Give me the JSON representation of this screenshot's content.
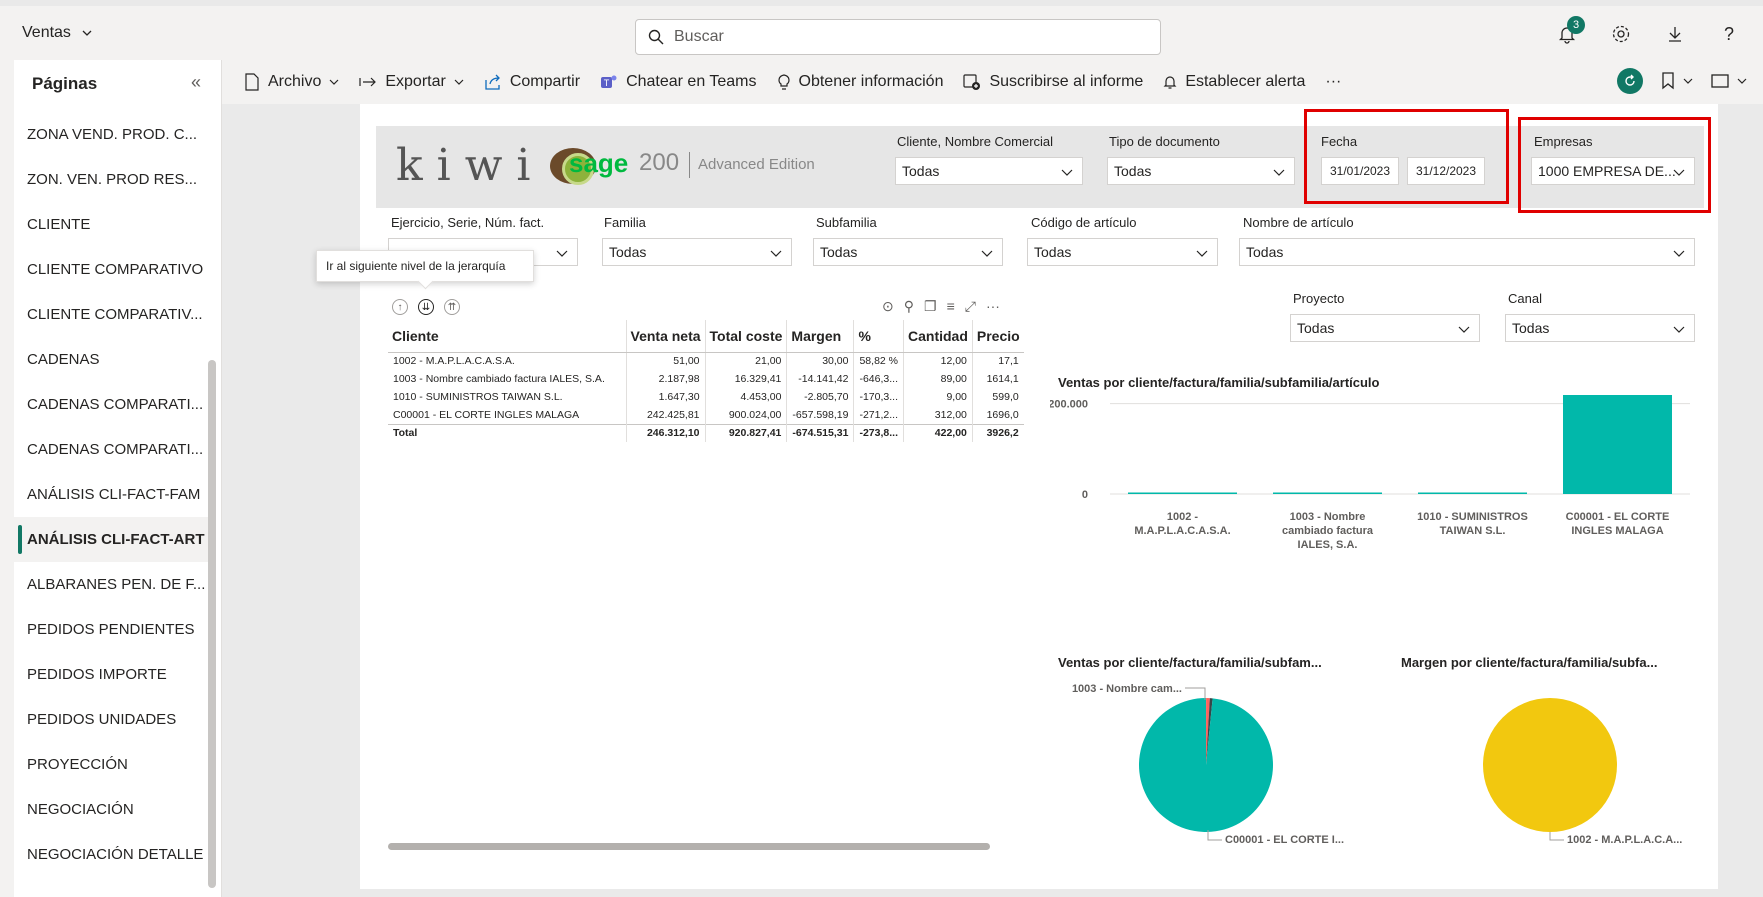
{
  "workspace": {
    "name": "Ventas"
  },
  "search": {
    "placeholder": "Buscar"
  },
  "notifications": {
    "count": "3"
  },
  "sidebar": {
    "title": "Páginas",
    "items": [
      {
        "label": "ZONA VEND. PROD. C..."
      },
      {
        "label": "ZON. VEN. PROD RES..."
      },
      {
        "label": "CLIENTE"
      },
      {
        "label": "CLIENTE COMPARATIVO"
      },
      {
        "label": "CLIENTE COMPARATIV..."
      },
      {
        "label": "CADENAS"
      },
      {
        "label": "CADENAS COMPARATI..."
      },
      {
        "label": "CADENAS COMPARATI..."
      },
      {
        "label": "ANÁLISIS CLI-FACT-FAM"
      },
      {
        "label": "ANÁLISIS CLI-FACT-ART",
        "active": true
      },
      {
        "label": "ALBARANES PEN. DE F..."
      },
      {
        "label": "PEDIDOS PENDIENTES"
      },
      {
        "label": "PEDIDOS IMPORTE"
      },
      {
        "label": "PEDIDOS UNIDADES"
      },
      {
        "label": "PROYECCIÓN"
      },
      {
        "label": "NEGOCIACIÓN"
      },
      {
        "label": "NEGOCIACIÓN DETALLE"
      }
    ]
  },
  "toolbar": {
    "archivo": "Archivo",
    "exportar": "Exportar",
    "compartir": "Compartir",
    "teams": "Chatear en Teams",
    "info": "Obtener información",
    "suscribirse": "Suscribirse al informe",
    "alerta": "Establecer alerta",
    "more": "···"
  },
  "header": {
    "kiwi": "kiwi",
    "sage": "sage",
    "sage_version": "200",
    "edition": "Advanced Edition"
  },
  "slicers": {
    "cliente": {
      "label": "Cliente, Nombre Comercial",
      "value": "Todas"
    },
    "tipo_doc": {
      "label": "Tipo de documento",
      "value": "Todas"
    },
    "fecha": {
      "label": "Fecha",
      "from": "31/01/2023",
      "to": "31/12/2023"
    },
    "empresas": {
      "label": "Empresas",
      "value": "1000 EMPRESA DE..."
    },
    "ejercicio": {
      "label": "Ejercicio, Serie, Núm. fact."
    },
    "familia": {
      "label": "Familia",
      "value": "Todas"
    },
    "subfamilia": {
      "label": "Subfamilia",
      "value": "Todas"
    },
    "codigo": {
      "label": "Código de artículo",
      "value": "Todas"
    },
    "nombre": {
      "label": "Nombre de artículo",
      "value": "Todas"
    },
    "proyecto": {
      "label": "Proyecto",
      "value": "Todas"
    },
    "canal": {
      "label": "Canal",
      "value": "Todas"
    }
  },
  "tooltip": {
    "text": "Ir al siguiente nivel de la jerarquía"
  },
  "matrix": {
    "headers": [
      "Cliente",
      "Venta neta",
      "Total coste",
      "Margen",
      "%",
      "Cantidad",
      "Precio"
    ],
    "rows": [
      [
        "1002 -  M.A.P.L.A.C.A.S.A.",
        "51,00",
        "21,00",
        "30,00",
        "58,82 %",
        "12,00",
        "17,1"
      ],
      [
        "1003 -  Nombre cambiado factura IALES, S.A.",
        "2.187,98",
        "16.329,41",
        "-14.141,42",
        "-646,3...",
        "89,00",
        "1614,1"
      ],
      [
        "1010 -  SUMINISTROS TAIWAN S.L.",
        "1.647,30",
        "4.453,00",
        "-2.805,70",
        "-170,3...",
        "9,00",
        "599,0"
      ],
      [
        "C00001 -  EL CORTE INGLES MALAGA",
        "242.425,81",
        "900.024,00",
        "-657.598,19",
        "-271,2...",
        "312,00",
        "1696,0"
      ]
    ],
    "total": [
      "Total",
      "246.312,10",
      "920.827,41",
      "-674.515,31",
      "-273,8...",
      "422,00",
      "3926,2"
    ]
  },
  "charts": {
    "bar_title": "Ventas por cliente/factura/familia/subfamilia/artículo",
    "pie1_title": "Ventas por cliente/factura/familia/subfam...",
    "pie2_title": "Margen por cliente/factura/familia/subfa..."
  },
  "chart_data": [
    {
      "type": "bar",
      "title": "Ventas por cliente/factura/familia/subfamilia/artículo",
      "categories": [
        "1002 - M.A.P.L.A.C.A.S.A.",
        "1003 - Nombre cambiado factura IALES, S.A.",
        "1010 - SUMINISTROS TAIWAN S.L.",
        "C00001 - EL CORTE INGLES MALAGA"
      ],
      "category_lines": [
        [
          "1002 -",
          "M.A.P.L.A.C.A.S.A."
        ],
        [
          "1003 - Nombre",
          "cambiado factura",
          "IALES, S.A."
        ],
        [
          "1010 - SUMINISTROS",
          "TAIWAN S.L."
        ],
        [
          "C00001 - EL CORTE",
          "INGLES MALAGA"
        ]
      ],
      "values": [
        51,
        2187.98,
        1647.3,
        242425.81
      ],
      "ylim": [
        0,
        250000
      ],
      "yticks": [
        0,
        200000
      ],
      "ytick_labels": [
        "0",
        "200.000"
      ],
      "color": "#01b8aa",
      "grid": true
    },
    {
      "type": "pie",
      "title": "Ventas por cliente/factura/familia/subfam...",
      "labels": [
        "1002 - M.A.P.L.A.C.A.S.A.",
        "1003 - Nombre cambiado factura IALES, S.A.",
        "1010 - SUMINISTROS TAIWAN S.L.",
        "C00001 - EL CORTE INGLES MALAGA"
      ],
      "values": [
        51,
        2187.98,
        1647.3,
        242425.81
      ],
      "colors": [
        "#f2c80f",
        "#fd625e",
        "#374649",
        "#01b8aa"
      ],
      "annotations": [
        "1003 - Nombre cam...",
        "C00001 - EL CORTE I..."
      ]
    },
    {
      "type": "pie",
      "title": "Margen por cliente/factura/familia/subfa...",
      "labels": [
        "1002 - M.A.P.L.A.C.A.S.A."
      ],
      "values": [
        30
      ],
      "colors": [
        "#f2c80f"
      ],
      "annotations": [
        "1002 - M.A.P.L.A.C.A..."
      ]
    }
  ]
}
